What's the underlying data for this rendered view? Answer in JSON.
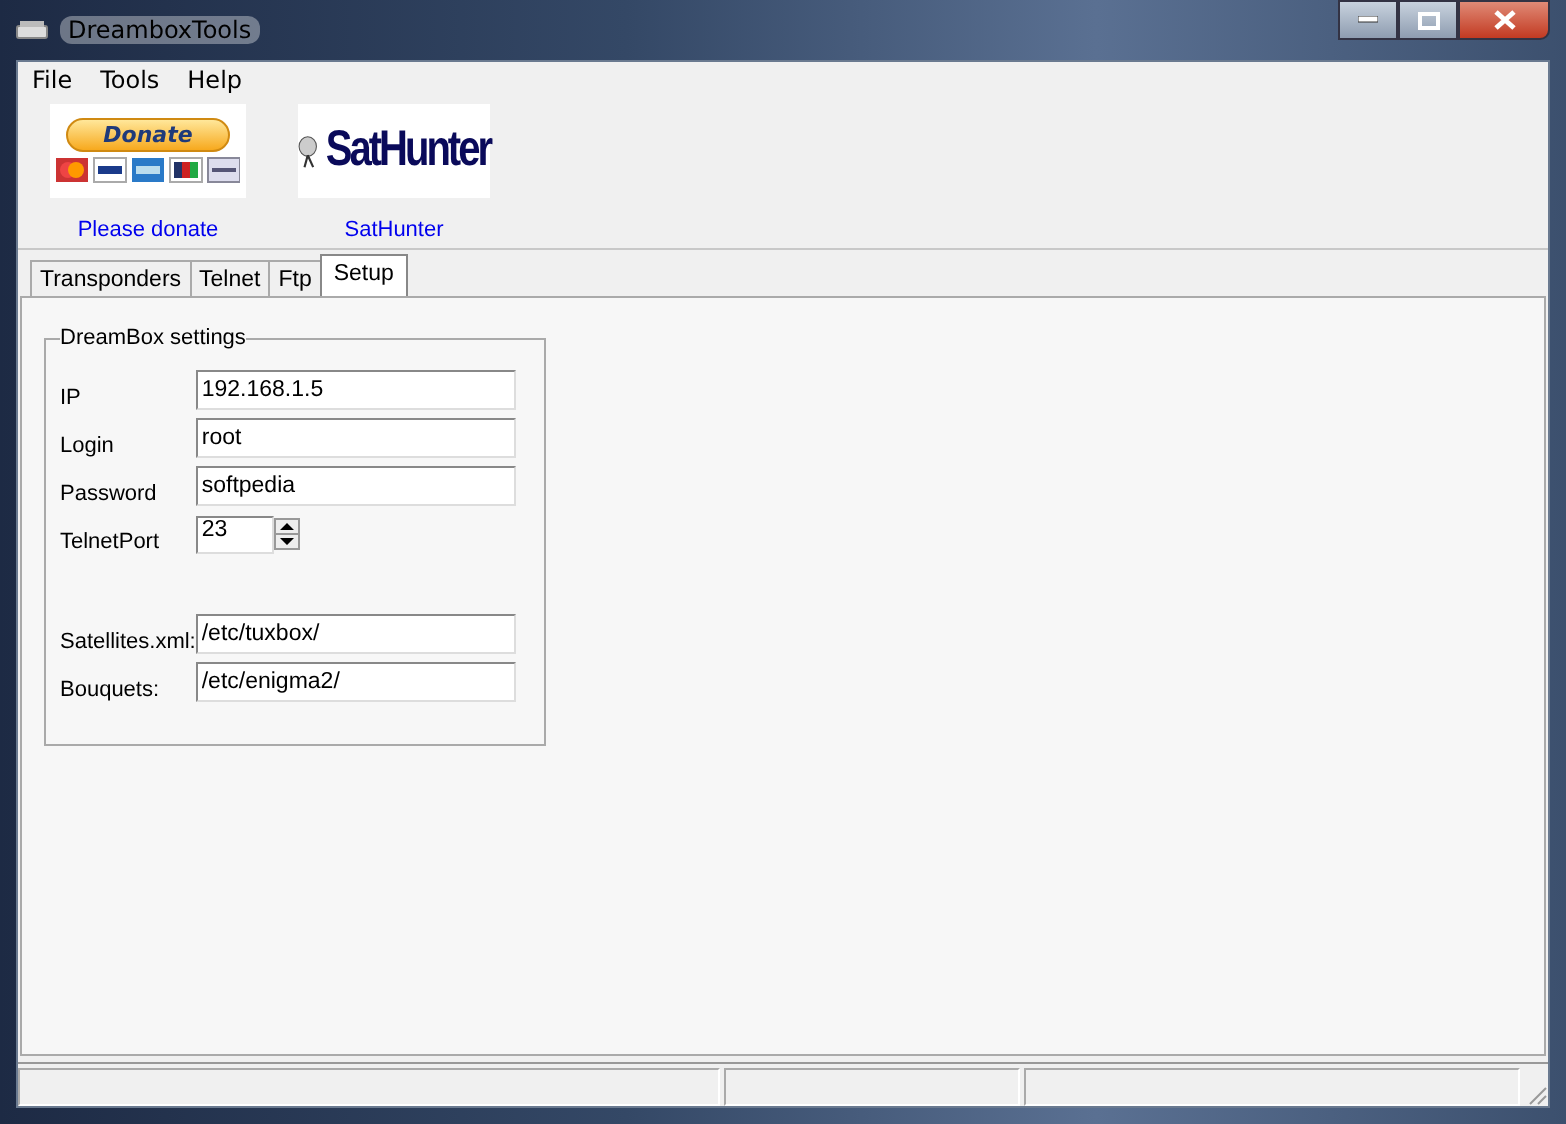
{
  "window": {
    "title": "DreamboxTools"
  },
  "menu": [
    "File",
    "Tools",
    "Help"
  ],
  "toolbar": {
    "donate": {
      "button": "Donate",
      "caption": "Please donate"
    },
    "sathunter": {
      "logo": "SatHunter",
      "caption": "SatHunter"
    }
  },
  "tabs": [
    {
      "label": "Transponders",
      "selected": false
    },
    {
      "label": "Telnet",
      "selected": false
    },
    {
      "label": "Ftp",
      "selected": false
    },
    {
      "label": "Setup",
      "selected": true
    }
  ],
  "group": {
    "title": "DreamBox settings",
    "fields": [
      {
        "kind": "text",
        "label": "IP",
        "value": "192.168.1.5"
      },
      {
        "kind": "text",
        "label": "Login",
        "value": "root"
      },
      {
        "kind": "text",
        "label": "Password",
        "value": "softpedia"
      },
      {
        "kind": "spin",
        "label": "TelnetPort",
        "value": "23"
      },
      {
        "kind": "gap"
      },
      {
        "kind": "text",
        "label": "Satellites.xml:",
        "value": "/etc/tuxbox/"
      },
      {
        "kind": "text",
        "label": "Bouquets:",
        "value": "/etc/enigma2/"
      }
    ]
  }
}
